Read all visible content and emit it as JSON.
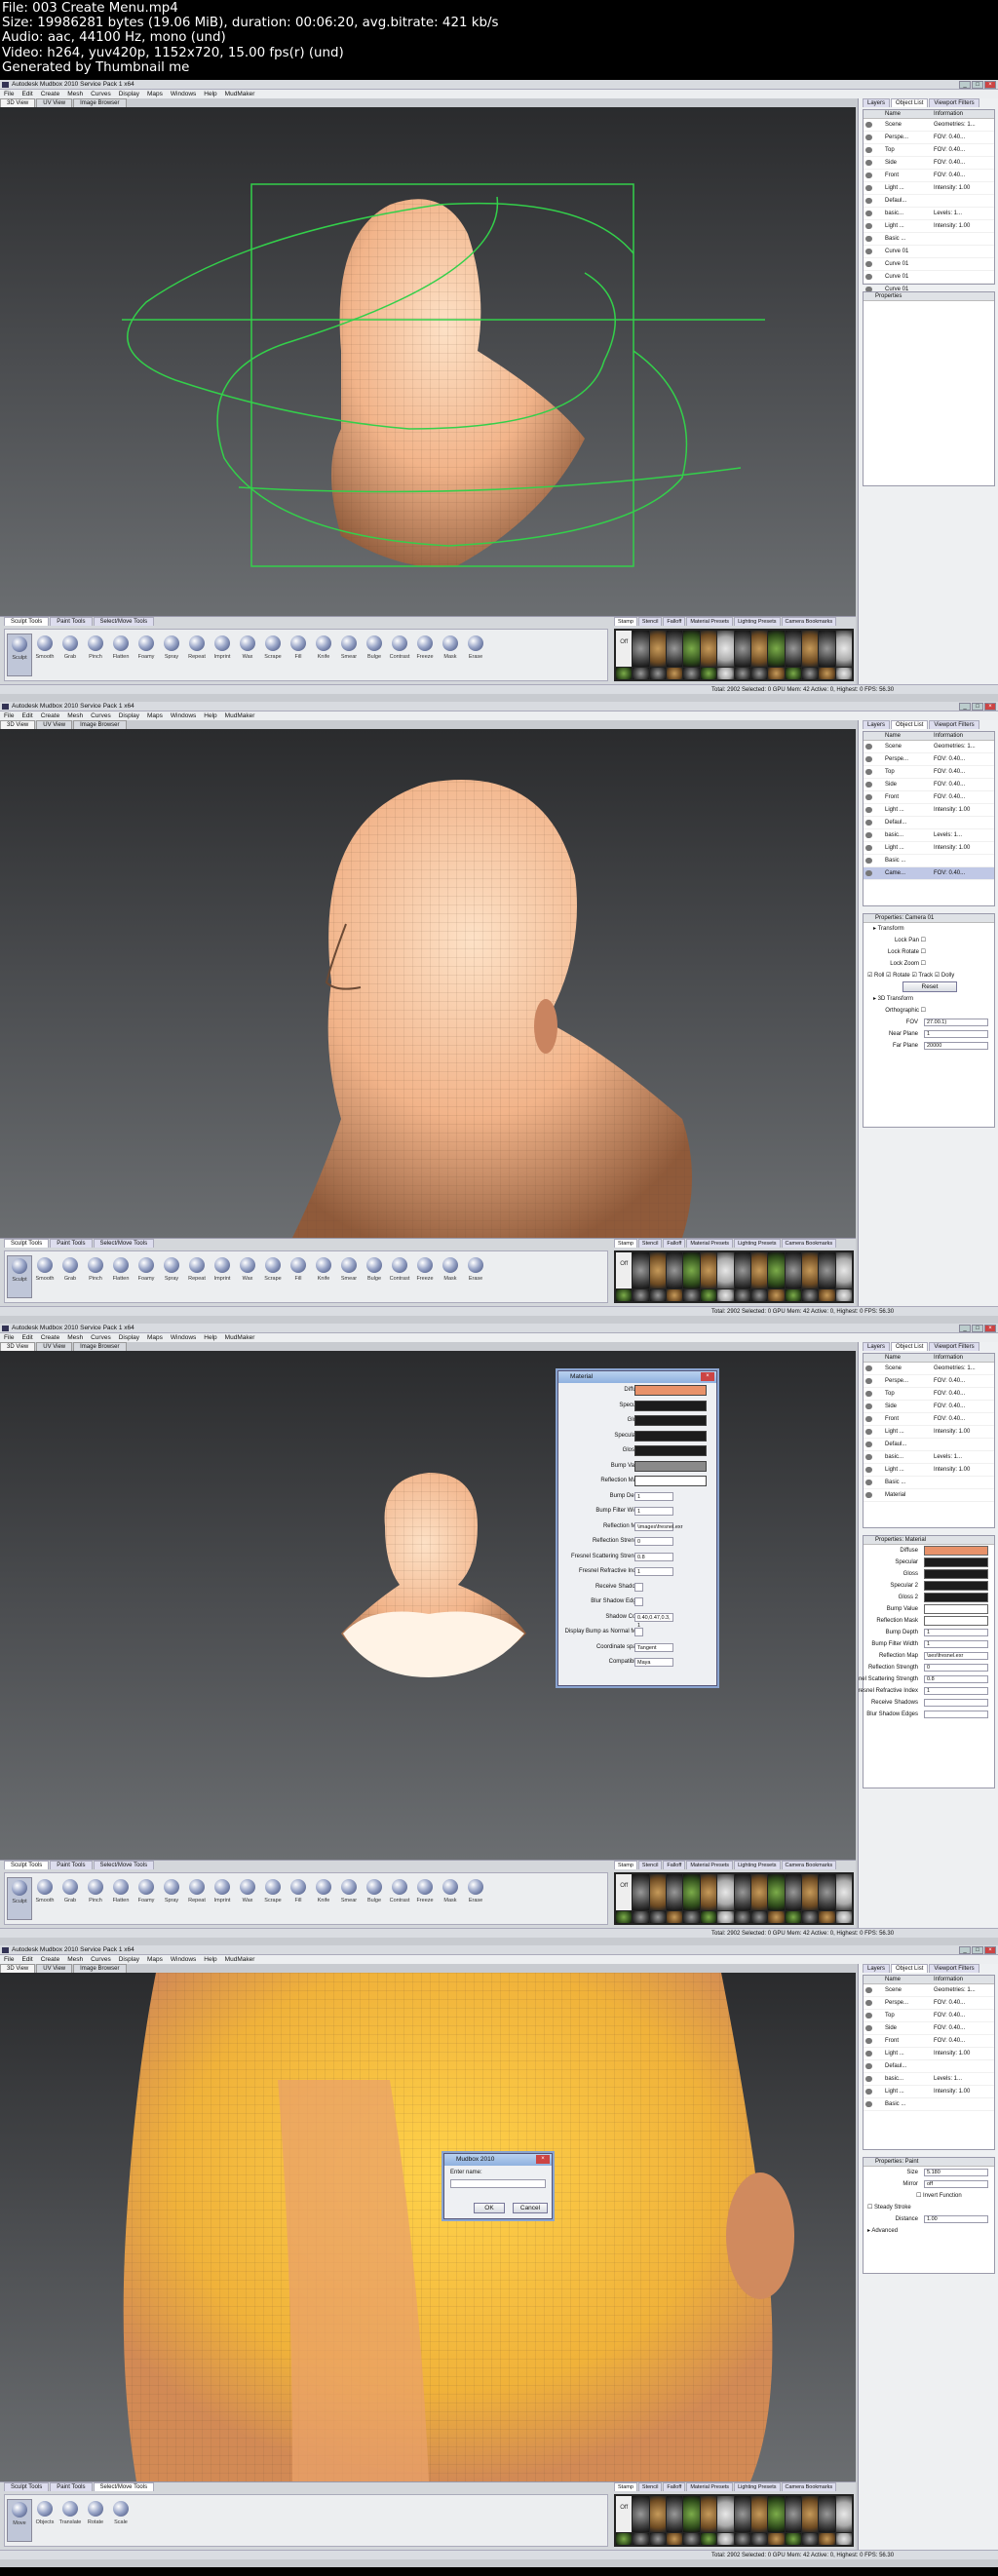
{
  "header": {
    "lines": [
      "File: 003 Create Menu.mp4",
      "Size: 19986281 bytes (19.06 MiB), duration: 00:06:20, avg.bitrate: 421 kb/s",
      "Audio: aac, 44100 Hz, mono (und)",
      "Video: h264, yuv420p, 1152x720, 15.00 fps(r) (und)",
      "Generated by Thumbnail me"
    ]
  },
  "app": {
    "title": "Autodesk Mudbox 2010 Service Pack 1 x64",
    "menus": [
      "File",
      "Edit",
      "Create",
      "Mesh",
      "Curves",
      "Display",
      "Maps",
      "Windows",
      "Help",
      "MudMaker"
    ],
    "viewport_tabs": [
      "3D View",
      "UV View",
      "Image Browser"
    ],
    "right_tabs": [
      "Layers",
      "Object List",
      "Viewport Filters"
    ],
    "object_list_headers": [
      "Name",
      "Information"
    ],
    "bottom_tabs": [
      "Sculpt Tools",
      "Paint Tools",
      "Select/Move Tools"
    ],
    "stamp_tabs": [
      "Stamp",
      "Stencil",
      "Falloff",
      "Material Presets",
      "Lighting Presets",
      "Camera Bookmarks"
    ],
    "stamp_off": "Off",
    "sculpt_tools": [
      "Sculpt",
      "Smooth",
      "Grab",
      "Pinch",
      "Flatten",
      "Foamy",
      "Spray",
      "Repeat",
      "Imprint",
      "Wax",
      "Scrape",
      "Fill",
      "Knife",
      "Smear",
      "Bulge",
      "Contrast",
      "Freeze",
      "Mask",
      "Erase"
    ],
    "move_tools": [
      "Move",
      "Objects",
      "Translate",
      "Rotate",
      "Scale"
    ],
    "status": "Total: 2902  Selected: 0  GPU Mem: 42  Active: 0, Highest: 0  FPS: 56.30"
  },
  "frames": [
    {
      "rows": [
        {
          "name": "Scene",
          "info": "Geometries: 1..."
        },
        {
          "name": "Perspe...",
          "info": "FOV: 0.40..."
        },
        {
          "name": "Top",
          "info": "FOV: 0.40..."
        },
        {
          "name": "Side",
          "info": "FOV: 0.40..."
        },
        {
          "name": "Front",
          "info": "FOV: 0.40..."
        },
        {
          "name": "Light ...",
          "info": "Intensity: 1.00"
        },
        {
          "name": "Defaul...",
          "info": ""
        },
        {
          "name": "basic...",
          "info": "Levels: 1..."
        },
        {
          "name": "Light ...",
          "info": "Intensity: 1.00"
        },
        {
          "name": "Basic ...",
          "info": ""
        },
        {
          "name": "Curve 01",
          "info": ""
        },
        {
          "name": "Curve 01",
          "info": ""
        },
        {
          "name": "Curve 01",
          "info": ""
        },
        {
          "name": "Curve 01",
          "info": ""
        },
        {
          "name": "Curve 01",
          "info": ""
        }
      ],
      "props_title": "Properties"
    },
    {
      "rows": [
        {
          "name": "Scene",
          "info": "Geometries: 1..."
        },
        {
          "name": "Perspe...",
          "info": "FOV: 0.40..."
        },
        {
          "name": "Top",
          "info": "FOV: 0.40..."
        },
        {
          "name": "Side",
          "info": "FOV: 0.40..."
        },
        {
          "name": "Front",
          "info": "FOV: 0.40..."
        },
        {
          "name": "Light ...",
          "info": "Intensity: 1.00"
        },
        {
          "name": "Defaul...",
          "info": ""
        },
        {
          "name": "basic...",
          "info": "Levels: 1..."
        },
        {
          "name": "Light ...",
          "info": "Intensity: 1.00"
        },
        {
          "name": "Basic ...",
          "info": ""
        },
        {
          "name": "Came...",
          "info": "FOV: 0.40...",
          "selected": true
        }
      ],
      "props_title": "Properties: Camera 01",
      "camera_props": {
        "transform": "Transform",
        "checks": [
          "Lock Pan",
          "Lock Rotate",
          "Lock Zoom"
        ],
        "toggles": [
          "Roll",
          "Rotate",
          "Track",
          "Dolly"
        ],
        "reset": "Reset",
        "transform3d": "3D Transform",
        "ortho": "Orthographic",
        "fov_label": "FOV",
        "fov": "27.00.1)",
        "near_label": "Near Plane",
        "near": "1",
        "far_label": "Far Plane",
        "far": "20000"
      }
    },
    {
      "rows": [
        {
          "name": "Scene",
          "info": "Geometries: 1..."
        },
        {
          "name": "Perspe...",
          "info": "FOV: 0.40..."
        },
        {
          "name": "Top",
          "info": "FOV: 0.40..."
        },
        {
          "name": "Side",
          "info": "FOV: 0.40..."
        },
        {
          "name": "Front",
          "info": "FOV: 0.40..."
        },
        {
          "name": "Light ...",
          "info": "Intensity: 1.00"
        },
        {
          "name": "Defaul...",
          "info": ""
        },
        {
          "name": "basic...",
          "info": "Levels: 1..."
        },
        {
          "name": "Light ...",
          "info": "Intensity: 1.00"
        },
        {
          "name": "Basic ...",
          "info": ""
        },
        {
          "name": "Material",
          "info": ""
        }
      ],
      "props_title": "Properties: Material",
      "material_dialog": {
        "title": "Material",
        "rows": [
          {
            "label": "Diffuse",
            "swatch": "#e8926a"
          },
          {
            "label": "Specular",
            "swatch": "#1c1c1c"
          },
          {
            "label": "Gloss",
            "swatch": "#1c1c1c"
          },
          {
            "label": "Specular 2",
            "swatch": "#1c1c1c"
          },
          {
            "label": "Gloss 2",
            "swatch": "#1c1c1c"
          },
          {
            "label": "Bump Value",
            "swatch": "#8a8a8a"
          },
          {
            "label": "Reflection Mask",
            "swatch": "#ffffff"
          },
          {
            "label": "Bump Depth",
            "value": "1"
          },
          {
            "label": "Bump Filter Width",
            "value": "1"
          },
          {
            "label": "Reflection Map",
            "value": "\\images\\fresnel.exr"
          },
          {
            "label": "Reflection Strength",
            "value": "0"
          },
          {
            "label": "Fresnel Scattering Strength",
            "value": "0.8"
          },
          {
            "label": "Fresnel Refractive Index",
            "value": "1"
          },
          {
            "label": "Receive Shadows",
            "value": ""
          },
          {
            "label": "Blur Shadow Edges",
            "value": ""
          },
          {
            "label": "Shadow Color",
            "value": "0.40,0.47,0.3, 1"
          },
          {
            "label": "Display Bump as Normal Map",
            "value": ""
          },
          {
            "label": "Coordinate space",
            "value": "Tangent"
          },
          {
            "label": "Compatibility",
            "value": "Maya"
          }
        ],
        "props_rows": [
          {
            "label": "Diffuse",
            "swatch": "#e8926a"
          },
          {
            "label": "Specular",
            "swatch": "#1c1c1c"
          },
          {
            "label": "Gloss",
            "swatch": "#1c1c1c"
          },
          {
            "label": "Specular 2",
            "swatch": "#1c1c1c"
          },
          {
            "label": "Gloss 2",
            "swatch": "#1c1c1c"
          },
          {
            "label": "Bump Value",
            "swatch": "#ffffff"
          },
          {
            "label": "Reflection Mask",
            "swatch": "#ffffff"
          },
          {
            "label": "Bump Depth",
            "value": "1"
          },
          {
            "label": "Bump Filter Width",
            "value": "1"
          },
          {
            "label": "Reflection Map",
            "value": "\\ses\\fresnel.exr"
          },
          {
            "label": "Reflection Strength",
            "value": "0"
          },
          {
            "label": "nel Scattering Strength",
            "value": "0.8"
          },
          {
            "label": "resnel Refractive Index",
            "value": "1"
          },
          {
            "label": "Receive Shadows",
            "value": ""
          },
          {
            "label": "Blur Shadow Edges",
            "value": ""
          }
        ]
      }
    },
    {
      "rows": [
        {
          "name": "Scene",
          "info": "Geometries: 1..."
        },
        {
          "name": "Perspe...",
          "info": "FOV: 0.40..."
        },
        {
          "name": "Top",
          "info": "FOV: 0.40..."
        },
        {
          "name": "Side",
          "info": "FOV: 0.40..."
        },
        {
          "name": "Front",
          "info": "FOV: 0.40..."
        },
        {
          "name": "Light ...",
          "info": "Intensity: 1.00"
        },
        {
          "name": "Defaul...",
          "info": ""
        },
        {
          "name": "basic...",
          "info": "Levels: 1..."
        },
        {
          "name": "Light ...",
          "info": "Intensity: 1.00"
        },
        {
          "name": "Basic ...",
          "info": ""
        }
      ],
      "props_title": "Properties: Paint",
      "paint_props": {
        "size_label": "Size",
        "size": "5.180",
        "mirror_label": "Mirror",
        "mirror": "off",
        "invert": "Invert Function",
        "steady": "Steady Stroke",
        "distance_label": "Distance",
        "distance": "1.00",
        "advanced": "Advanced"
      },
      "name_dialog": {
        "title": "Mudbox 2010",
        "prompt": "Enter name:",
        "ok": "OK",
        "cancel": "Cancel"
      }
    }
  ]
}
